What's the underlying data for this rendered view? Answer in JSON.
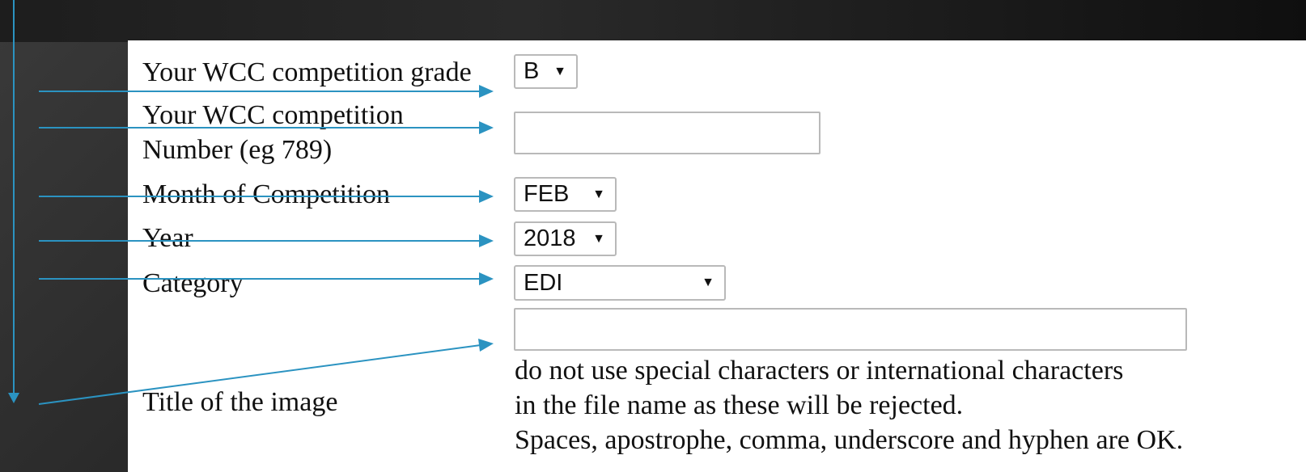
{
  "form": {
    "grade": {
      "label": "Your WCC competition grade",
      "value": "B"
    },
    "number": {
      "label_line1": "Your WCC competition",
      "label_line2": "Number (eg 789)",
      "value": ""
    },
    "month": {
      "label": "Month of Competition",
      "value": "FEB"
    },
    "year": {
      "label": "Year",
      "value": "2018"
    },
    "category": {
      "label": "Category",
      "value": "EDI"
    },
    "title": {
      "label": "Title of the image",
      "value": "",
      "note_line1": "do not use special characters or international characters",
      "note_line2": "in the file name as these will be rejected.",
      "note_line3": "Spaces, apostrophe, comma, underscore and hyphen are OK."
    }
  },
  "icons": {
    "dropdown": "triangle-down-icon"
  },
  "colors": {
    "arrow": "#2b93c1",
    "panel": "#ffffff"
  }
}
